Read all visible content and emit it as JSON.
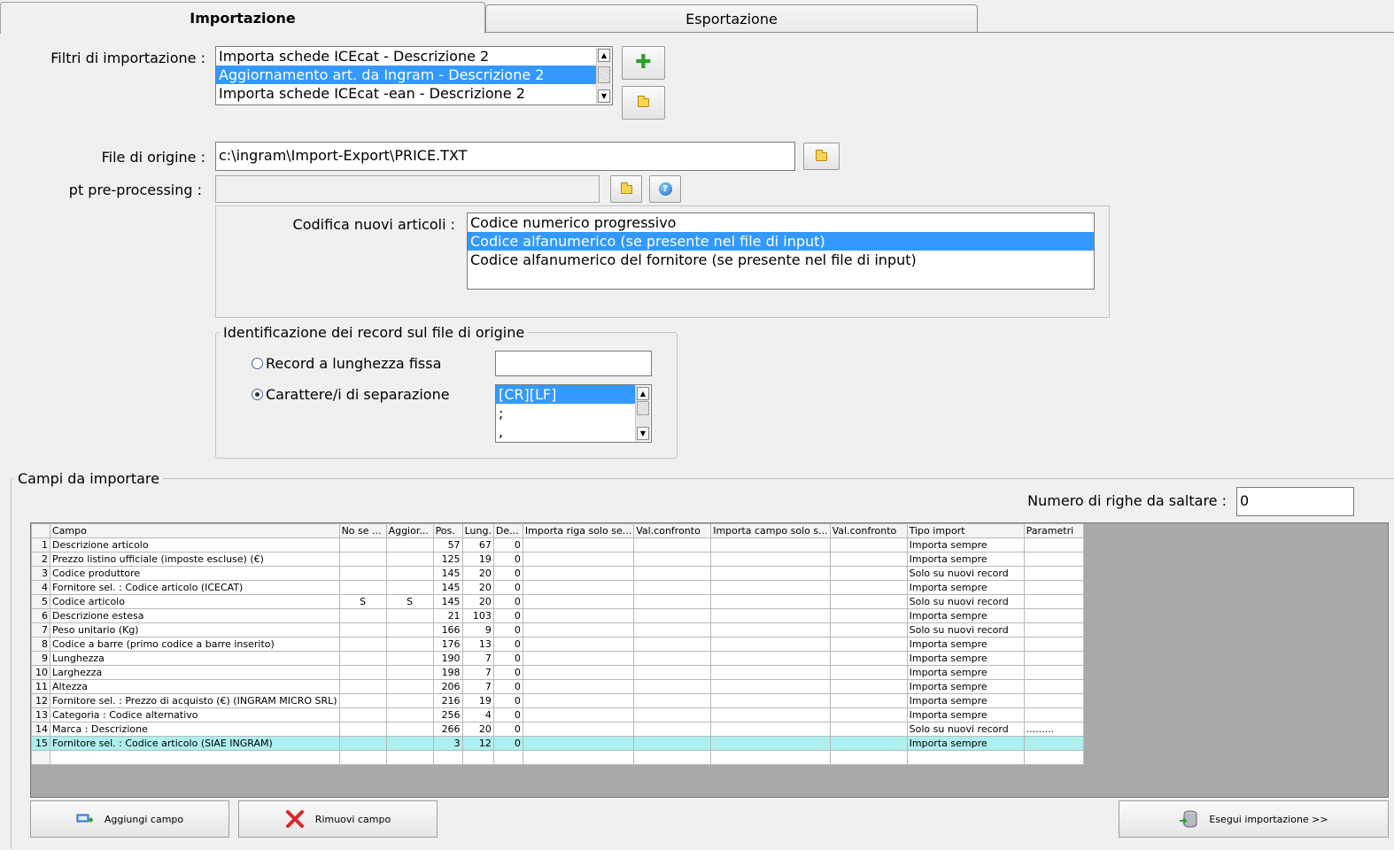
{
  "tabs": [
    {
      "label": "Importazione",
      "active": true
    },
    {
      "label": "Esportazione",
      "active": false
    }
  ],
  "filters": {
    "label": "Filtri di importazione :",
    "items": [
      "Importa schede ICEcat - Descrizione 2",
      "Aggiornamento art. da Ingram - Descrizione 2",
      "Importa schede ICEcat -ean - Descrizione 2"
    ],
    "selected_index": 1
  },
  "source_file": {
    "label": "File di origine :",
    "value": "c:\\ingram\\Import-Export\\PRICE.TXT"
  },
  "preprocessing": {
    "label": "pt pre-processing :",
    "value": ""
  },
  "coding": {
    "label": "Codifica nuovi articoli :",
    "items": [
      "Codice numerico progressivo",
      "Codice alfanumerico (se presente nel file di input)",
      "Codice alfanumerico del fornitore (se presente nel file di input)"
    ],
    "selected_index": 1
  },
  "identification": {
    "legend": "Identificazione dei record sul file di origine",
    "fixed_label": "Record a lunghezza fissa",
    "fixed_value": "",
    "sep_label": "Carattere/i di separazione",
    "sep_selected": "sep",
    "separators": [
      "[CR][LF]",
      ";",
      ","
    ],
    "sep_selected_index": 0
  },
  "fields": {
    "legend": "Campi da importare",
    "skip_label": "Numero di righe da saltare  :",
    "skip_value": "0",
    "columns": [
      "",
      "Campo",
      "No se ...",
      "Aggior...",
      "Pos.",
      "Lung.",
      "De...",
      "Importa riga solo se...",
      "Val.confronto",
      "Importa campo solo s...",
      "Val.confronto",
      "Tipo import",
      "Parametri"
    ],
    "rows": [
      [
        "1",
        "Descrizione articolo",
        "",
        "",
        "57",
        "67",
        "0",
        "",
        "",
        "",
        "",
        "Importa sempre",
        ""
      ],
      [
        "2",
        "Prezzo listino ufficiale (imposte escluse) (€)",
        "",
        "",
        "125",
        "19",
        "0",
        "",
        "",
        "",
        "",
        "Importa sempre",
        ""
      ],
      [
        "3",
        "Codice produttore",
        "",
        "",
        "145",
        "20",
        "0",
        "",
        "",
        "",
        "",
        "Solo su nuovi record",
        ""
      ],
      [
        "4",
        "Fornitore sel. : Codice articolo (ICECAT)",
        "",
        "",
        "145",
        "20",
        "0",
        "",
        "",
        "",
        "",
        "Importa sempre",
        ""
      ],
      [
        "5",
        "Codice articolo",
        "S",
        "S",
        "145",
        "20",
        "0",
        "",
        "",
        "",
        "",
        "Solo su nuovi record",
        ""
      ],
      [
        "6",
        "Descrizione estesa",
        "",
        "",
        "21",
        "103",
        "0",
        "",
        "",
        "",
        "",
        "Importa sempre",
        ""
      ],
      [
        "7",
        "Peso unitario (Kg)",
        "",
        "",
        "166",
        "9",
        "0",
        "",
        "",
        "",
        "",
        "Solo su nuovi record",
        ""
      ],
      [
        "8",
        "Codice a barre (primo codice a barre inserito)",
        "",
        "",
        "176",
        "13",
        "0",
        "",
        "",
        "",
        "",
        "Importa sempre",
        ""
      ],
      [
        "9",
        "Lunghezza",
        "",
        "",
        "190",
        "7",
        "0",
        "",
        "",
        "",
        "",
        "Importa sempre",
        ""
      ],
      [
        "10",
        "Larghezza",
        "",
        "",
        "198",
        "7",
        "0",
        "",
        "",
        "",
        "",
        "Importa sempre",
        ""
      ],
      [
        "11",
        "Altezza",
        "",
        "",
        "206",
        "7",
        "0",
        "",
        "",
        "",
        "",
        "Importa sempre",
        ""
      ],
      [
        "12",
        "Fornitore sel. : Prezzo di acquisto (€) (INGRAM MICRO SRL)",
        "",
        "",
        "216",
        "19",
        "0",
        "",
        "",
        "",
        "",
        "Importa sempre",
        ""
      ],
      [
        "13",
        "Categoria : Codice alternativo",
        "",
        "",
        "256",
        "4",
        "0",
        "",
        "",
        "",
        "",
        "Importa sempre",
        ""
      ],
      [
        "14",
        "Marca : Descrizione",
        "",
        "",
        "266",
        "20",
        "0",
        "",
        "",
        "",
        "",
        "Solo su nuovi record",
        "........."
      ],
      [
        "15",
        "Fornitore sel. : Codice articolo (SIAE INGRAM)",
        "",
        "",
        "3",
        "12",
        "0",
        "",
        "",
        "",
        "",
        "Importa sempre",
        ""
      ],
      [
        "",
        "",
        "",
        "",
        "",
        "",
        "",
        "",
        "",
        "",
        "",
        "",
        ""
      ]
    ],
    "highlight_row": 14
  },
  "buttons": {
    "add_field": "Aggiungi campo",
    "remove_field": "Rimuovi campo",
    "run_import": "Esegui importazione >>"
  },
  "colors": {
    "selection": "#3399ff",
    "row_highlight": "#aeefef"
  }
}
